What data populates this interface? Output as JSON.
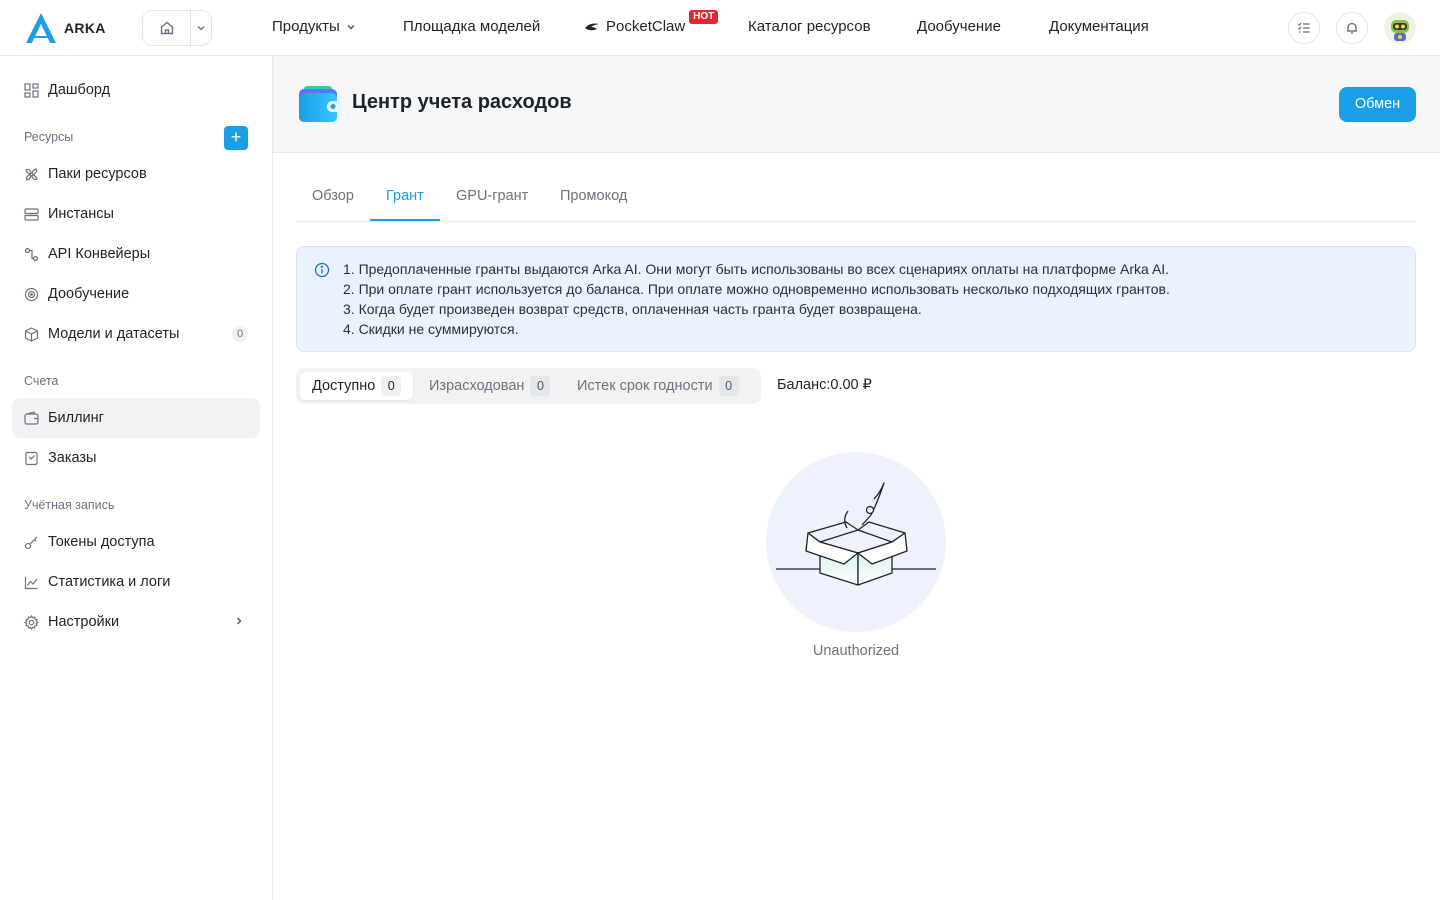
{
  "brand": {
    "name": "ARKA",
    "accent": "#1a9ee8"
  },
  "topnav": {
    "items": [
      {
        "label": "Продукты"
      },
      {
        "label": "Площадка моделей"
      },
      {
        "label": "PocketClaw",
        "badge": "HOT"
      },
      {
        "label": "Каталог ресурсов"
      },
      {
        "label": "Дообучение"
      },
      {
        "label": "Документация"
      }
    ],
    "icons": [
      "home-icon",
      "chevron-down-icon",
      "task-list-icon",
      "bell-icon",
      "avatar"
    ]
  },
  "sidebar": {
    "dashboard": "Дашборд",
    "section_resources": "Ресурсы",
    "resources": [
      {
        "label": "Паки ресурсов",
        "icon": "fan-icon"
      },
      {
        "label": "Инстансы",
        "icon": "server-icon"
      },
      {
        "label": "API Конвейеры",
        "icon": "pipeline-icon"
      },
      {
        "label": "Дообучение",
        "icon": "target-icon"
      },
      {
        "label": "Модели и датасеты",
        "icon": "cube-icon",
        "count": "0"
      }
    ],
    "section_accounts": "Счета",
    "accounts": [
      {
        "label": "Биллинг",
        "icon": "wallet-icon",
        "active": true
      },
      {
        "label": "Заказы",
        "icon": "order-icon"
      }
    ],
    "section_profile": "Учётная запись",
    "profile": [
      {
        "label": "Токены доступа",
        "icon": "key-icon"
      },
      {
        "label": "Статистика и логи",
        "icon": "chart-icon"
      },
      {
        "label": "Настройки",
        "icon": "gear-icon"
      }
    ]
  },
  "header": {
    "title": "Центр учета расходов",
    "exchange_button": "Обмен"
  },
  "tabs": [
    {
      "label": "Обзор"
    },
    {
      "label": "Грант",
      "active": true
    },
    {
      "label": "GPU-грант"
    },
    {
      "label": "Промокод"
    }
  ],
  "info": {
    "lines": [
      "1. Предоплаченные гранты выдаются Arka AI. Они могут быть использованы во всех сценариях оплаты на платформе Arka AI.",
      "2. При оплате грант используется до баланса. При оплате можно одновременно использовать несколько подходящих грантов.",
      "3. Когда будет произведен возврат средств, оплаченная часть гранта будет возвращена.",
      "4. Скидки не суммируются."
    ]
  },
  "filters": [
    {
      "label": "Доступно",
      "count": "0",
      "active": true
    },
    {
      "label": "Израсходован",
      "count": "0"
    },
    {
      "label": "Истек срок годности",
      "count": "0"
    }
  ],
  "balance": "Баланс:0.00 ₽",
  "empty": {
    "text": "Unauthorized"
  }
}
